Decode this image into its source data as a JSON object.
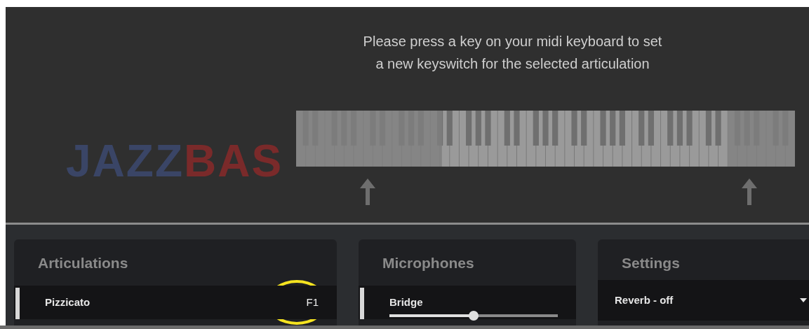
{
  "prompt": {
    "lines": [
      "Please press a key on your midi keyboard to set",
      "a new keyswitch for the selected articulation"
    ]
  },
  "logo": {
    "parts": [
      "JAZZ",
      "BAS"
    ]
  },
  "panels": [
    {
      "kind": "articulations",
      "title": "Articulations",
      "items": [
        {
          "label": "Pizzicato",
          "key": "F1",
          "selected": true,
          "highlighted": true
        }
      ]
    },
    {
      "kind": "microphones",
      "title": "Microphones",
      "items": [
        {
          "label": "Bridge",
          "selected": true,
          "level": 0.5
        }
      ]
    },
    {
      "kind": "settings",
      "title": "Settings",
      "items": [
        {
          "label": "Reverb - off"
        }
      ]
    }
  ]
}
